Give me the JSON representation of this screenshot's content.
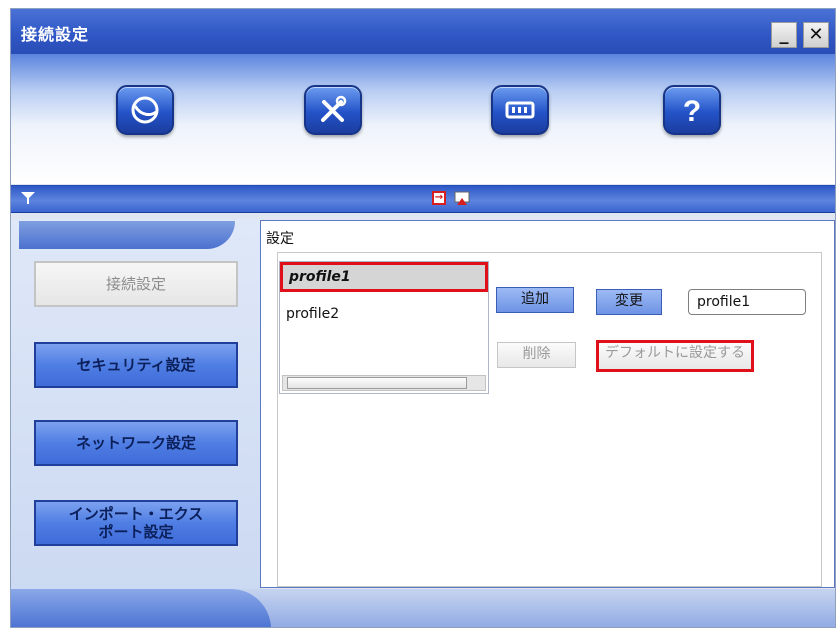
{
  "window": {
    "title": "接続設定",
    "minimize_label": "_",
    "close_label": "✕"
  },
  "toolbar": {
    "icons": [
      "globe-icon",
      "tools-icon",
      "device-icon",
      "help-icon"
    ],
    "help_label": "?"
  },
  "strip": {
    "icons": [
      "filter-icon",
      "exit-icon",
      "flag-icon"
    ]
  },
  "sidebar": {
    "items": [
      {
        "label": "接続設定",
        "active": true
      },
      {
        "label": "セキュリティ設定",
        "active": false
      },
      {
        "label": "ネットワーク設定",
        "active": false
      },
      {
        "label": "インポート・エクス\nポート設定",
        "active": false
      }
    ]
  },
  "settings": {
    "group_label": "設定",
    "profiles": [
      "profile1",
      "profile2"
    ],
    "selected_profile": "profile1",
    "add_label": "追加",
    "change_label": "変更",
    "delete_label": "削除",
    "default_label": "デフォルトに設定する",
    "name_value": "profile1"
  },
  "colors": {
    "accent": "#2f56c4",
    "highlight": "#e0101a"
  }
}
